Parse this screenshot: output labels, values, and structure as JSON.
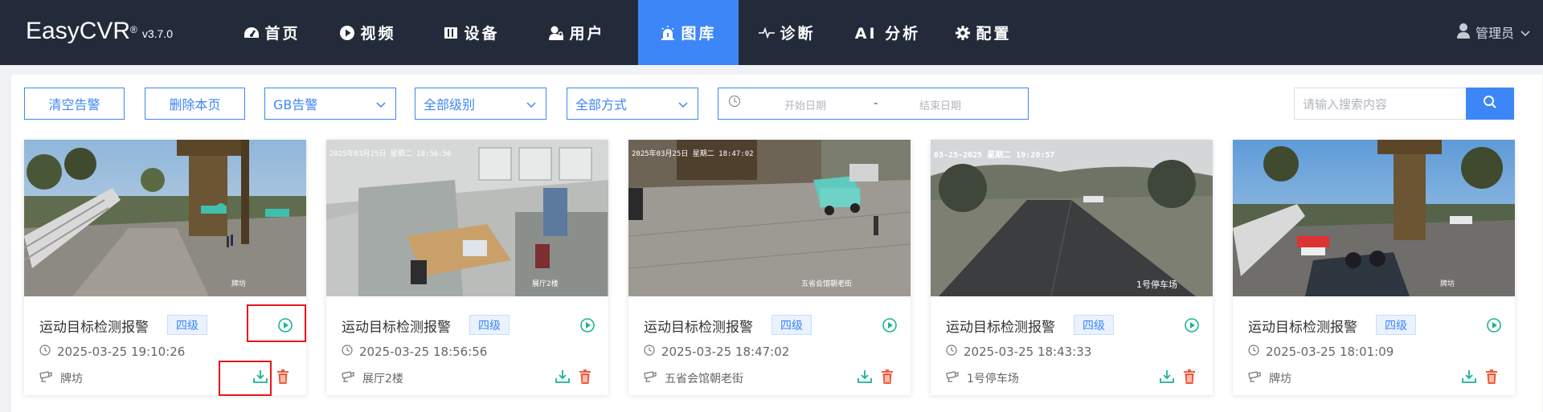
{
  "app": {
    "name": "EasyCVR",
    "version_mark": "®",
    "version": "v3.7.0"
  },
  "nav": [
    {
      "label": "首页",
      "icon": "dashboard-icon",
      "active": false
    },
    {
      "label": "视频",
      "icon": "play-circle-icon",
      "active": false
    },
    {
      "label": "设备",
      "icon": "device-icon",
      "active": false
    },
    {
      "label": "用户",
      "icon": "user-lock-icon",
      "active": false
    },
    {
      "label": "图库",
      "icon": "alarm-icon",
      "active": true
    },
    {
      "label": "诊断",
      "icon": "pulse-icon",
      "active": false
    },
    {
      "label": "AI 分析",
      "icon": "",
      "active": false
    },
    {
      "label": "配置",
      "icon": "gear-icon",
      "active": false
    }
  ],
  "user": {
    "name": "管理员"
  },
  "toolbar": {
    "clear_label": "清空告警",
    "delete_page_label": "删除本页",
    "type_select": "GB告警",
    "level_select": "全部级别",
    "method_select": "全部方式",
    "start_placeholder": "开始日期",
    "date_sep": "-",
    "end_placeholder": "结束日期",
    "search_placeholder": "请输入搜索内容"
  },
  "colors": {
    "accent": "#3d86f7",
    "topbar": "#232b3b",
    "green": "#1ab394",
    "red": "#f05a3a",
    "highlight": "#e8161b"
  },
  "cards": [
    {
      "title": "运动目标检测报警",
      "level": "四级",
      "time": "2025-03-25 19:10:26",
      "location": "牌坊",
      "stamp": "",
      "overlay": "牌坊"
    },
    {
      "title": "运动目标检测报警",
      "level": "四级",
      "time": "2025-03-25 18:56:56",
      "location": "展厅2楼",
      "stamp": "2025年03月25日 星期二 18:56:56",
      "overlay": "展厅2楼"
    },
    {
      "title": "运动目标检测报警",
      "level": "四级",
      "time": "2025-03-25 18:47:02",
      "location": "五省会馆朝老街",
      "stamp": "2025年03月25日 星期二 18:47:02",
      "overlay": "五省会馆朝老街"
    },
    {
      "title": "运动目标检测报警",
      "level": "四级",
      "time": "2025-03-25 18:43:33",
      "location": "1号停车场",
      "stamp": "03-25-2025 星期二 19:20:57",
      "overlay": "1号停车场"
    },
    {
      "title": "运动目标检测报警",
      "level": "四级",
      "time": "2025-03-25 18:01:09",
      "location": "牌坊",
      "stamp": "",
      "overlay": "牌坊"
    }
  ]
}
